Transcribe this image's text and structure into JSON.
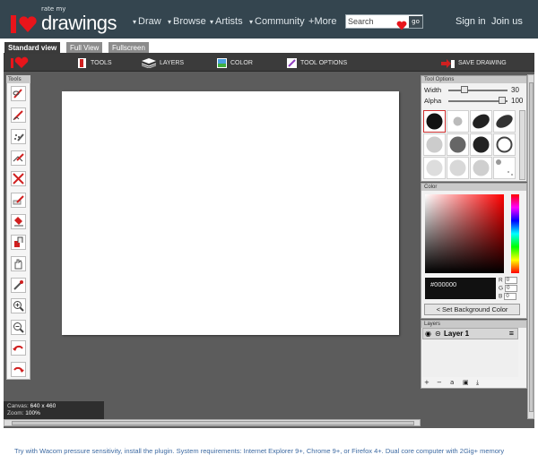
{
  "header": {
    "logo_small": "rate my",
    "logo_big": "drawings",
    "nav": [
      {
        "label": "Draw",
        "dropdown": true
      },
      {
        "label": "Browse",
        "dropdown": true
      },
      {
        "label": "Artists",
        "dropdown": true
      },
      {
        "label": "Community",
        "dropdown": true
      },
      {
        "label": "More",
        "prefix": "+"
      }
    ],
    "search_placeholder": "Search",
    "search_go": "go",
    "sign_in": "Sign in",
    "join_us": "Join us",
    "colors": {
      "bar": "#34454f",
      "accent": "#e8151b"
    }
  },
  "tabs": [
    "Standard view",
    "Full View",
    "Fullscreen"
  ],
  "toolbar": {
    "tools": "TOOLS",
    "layers": "LAYERS",
    "color": "COLOR",
    "tool_options": "TOOL OPTIONS",
    "save_drawing": "SAVE DRAWING"
  },
  "tools_panel": {
    "title": "Tools",
    "items": [
      "pencil-icon",
      "pen-icon",
      "airbrush-icon",
      "marker-icon",
      "eraser-icon",
      "highlighter-icon",
      "fill-icon",
      "smudge-icon",
      "pan-hand-icon",
      "eyedropper-icon",
      "zoom-in-icon",
      "zoom-out-icon",
      "undo-icon",
      "redo-icon"
    ]
  },
  "status": {
    "canvas_label": "Canvas:",
    "canvas_value": "640 x 460",
    "zoom_label": "Zoom:",
    "zoom_value": "100%"
  },
  "tool_options": {
    "title": "Tool Options",
    "width_label": "Width",
    "width_value": "30",
    "alpha_label": "Alpha",
    "alpha_value": "100"
  },
  "color": {
    "title": "Color",
    "hex": "#000000",
    "r": "0",
    "g": "0",
    "b": "0",
    "set_background": "< Set Background Color"
  },
  "layers": {
    "title": "Layers",
    "items": [
      {
        "name": "Layer 1"
      }
    ],
    "actions": [
      "+",
      "−",
      "a",
      "",
      ""
    ]
  },
  "footer": {
    "text": "Try with Wacom pressure sensitivity, install the plugin. System requirements: Internet Explorer 9+, Chrome 9+, or Firefox 4+. Dual core computer with 2Gig+ memory"
  }
}
